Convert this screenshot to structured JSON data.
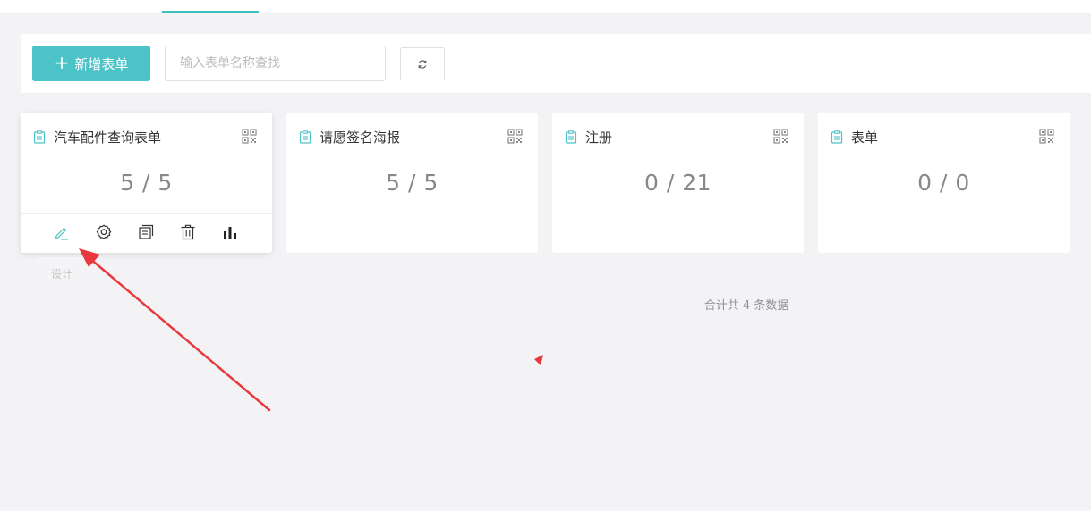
{
  "toolbar": {
    "add_label": "新增表单",
    "search_placeholder": "输入表单名称查找"
  },
  "cards": [
    {
      "title": "汽车配件查询表单",
      "count": "5 / 5"
    },
    {
      "title": "请愿签名海报",
      "count": "5 / 5"
    },
    {
      "title": "注册",
      "count": "0 / 21"
    },
    {
      "title": "表单",
      "count": "0 / 0"
    }
  ],
  "tooltip": {
    "label": "设计"
  },
  "footer": {
    "total_text": "— 合计共 4 条数据 —"
  },
  "colors": {
    "accent": "#4cc3c7",
    "annotation_arrow": "#e8383d",
    "background": "#f3f3f5"
  },
  "icons": {
    "card_title": "document-icon",
    "card_corner": "qrcode-icon",
    "refresh": "refresh-icon",
    "actions": [
      "edit-pencil-icon",
      "settings-gear-icon",
      "copy-icon",
      "delete-trash-icon",
      "statistics-bar-icon"
    ]
  }
}
